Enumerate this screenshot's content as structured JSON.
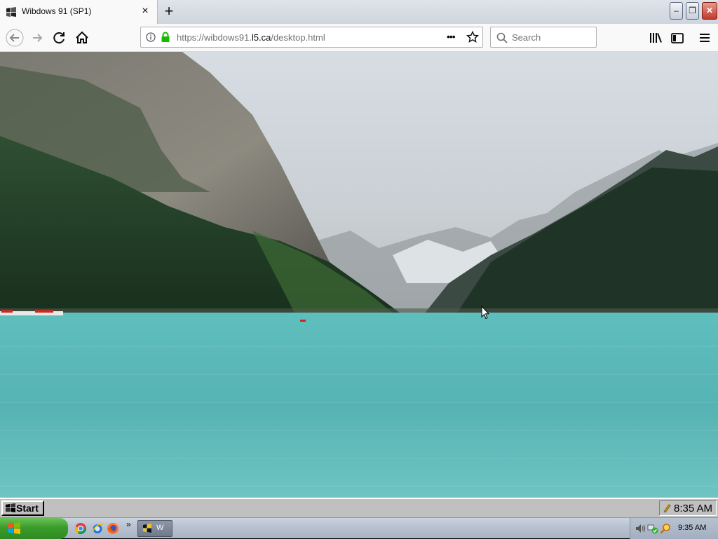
{
  "browser": {
    "tab_title": "Wibdows 91 (SP1)",
    "tab_close_label": "×",
    "new_tab_label": "+",
    "window_buttons": {
      "minimize": "–",
      "maximize": "❐",
      "close": "✕"
    },
    "url": {
      "prefix": "https://wibdows91.",
      "host": "l5.ca",
      "path": "/desktop.html"
    },
    "page_actions_label": "•••",
    "search_placeholder": "Search"
  },
  "page": {
    "wallpaper": "lake-mountains-photo",
    "taskbar": {
      "start_label": "Start",
      "clock": "8:35 AM"
    }
  },
  "host_taskbar": {
    "quick_launch": [
      "chrome-icon",
      "internet-explorer-icon",
      "firefox-icon"
    ],
    "overflow_label": "»",
    "task_label": "W",
    "clock": "9:35 AM"
  },
  "colors": {
    "lake": "#5cc0bf",
    "forest": "#1f3a24",
    "sky": "#dfe4e8"
  }
}
